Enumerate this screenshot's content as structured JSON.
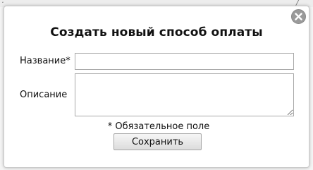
{
  "background": {
    "glyph_left": "·",
    "glyph_right": "/"
  },
  "dialog": {
    "title": "Создать новый способ оплаты",
    "close_icon": "close-icon",
    "fields": {
      "name_label": "Название*",
      "name_value": "",
      "description_label": "Описание",
      "description_value": ""
    },
    "required_note": "* Обязательное поле",
    "save_label": "Сохранить"
  },
  "colors": {
    "close_button": "#9a9a9a",
    "border": "#c9c9c9"
  }
}
